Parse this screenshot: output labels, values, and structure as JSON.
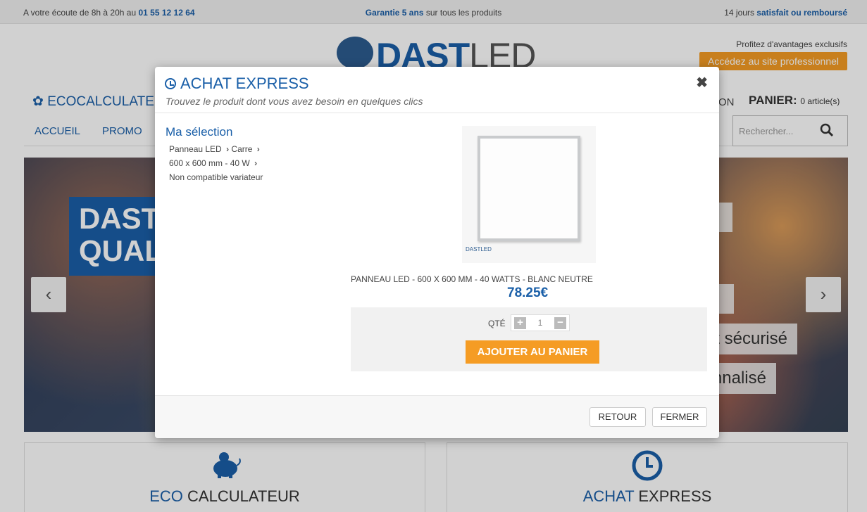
{
  "topbar": {
    "left_text": "A votre écoute de 8h à 20h au",
    "phone": "01 55 12 12 64",
    "center_bold": "Garantie 5 ans",
    "center_text": "sur tous les produits",
    "right_text": "14 jours",
    "right_bold": "satisfait ou remboursé"
  },
  "logo": {
    "part1": "DAST",
    "part2": "LED"
  },
  "pro": {
    "text": "Profitez d'avantages exclusifs",
    "button": "Accédez au site professionnel"
  },
  "nav": {
    "eco": "ECOCALCULATEUR",
    "partial": "ON",
    "cart_label": "PANIER:",
    "cart_count": "0 article(s)",
    "menu": [
      "ACCUEIL",
      "PROMO"
    ],
    "search_placeholder": "Rechercher..."
  },
  "hero": {
    "banner_line1": "DASTLED",
    "banner_line2": "QUALITÉ",
    "tag1": "s",
    "tag2": "s",
    "tag3": "Paiement sécurisé",
    "tag4": "Service personnalisé",
    "prev": "‹",
    "next": "›"
  },
  "cards": {
    "eco_prefix": "ECO",
    "eco_suffix": "CALCULATEUR",
    "ae_prefix": "ACHAT",
    "ae_suffix": "EXPRESS"
  },
  "modal": {
    "title": "ACHAT EXPRESS",
    "subtitle": "Trouvez le produit dont vous avez besoin en quelques clics",
    "close": "✖",
    "selection_title": "Ma sélection",
    "selection": {
      "cat1": "Panneau LED",
      "cat2": "Carre",
      "size": "600 x 600 mm - 40 W",
      "dim": "Non compatible variateur"
    },
    "product_brand": "DASTLED",
    "product_name": "PANNEAU LED - 600 X 600 MM - 40 WATTS - BLANC NEUTRE",
    "price": "78.25€",
    "qty_label": "QTÉ",
    "qty_value": "1",
    "add_button": "AJOUTER AU PANIER",
    "back_button": "RETOUR",
    "close_button": "FERMER"
  },
  "colors": {
    "brand_blue": "#1a5fa8",
    "accent_orange": "#f59c24"
  }
}
